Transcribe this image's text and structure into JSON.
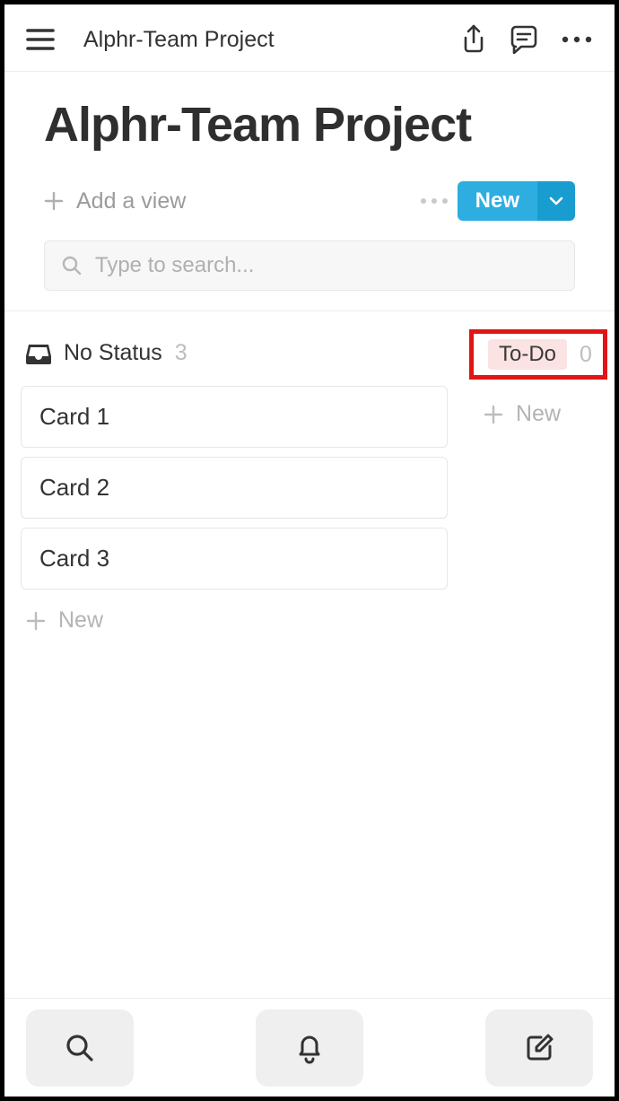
{
  "topbar": {
    "title": "Alphr-Team Project"
  },
  "page": {
    "title": "Alphr-Team Project"
  },
  "views": {
    "add_label": "Add a view",
    "new_label": "New"
  },
  "search": {
    "placeholder": "Type to search..."
  },
  "board": {
    "columns": [
      {
        "key": "no_status",
        "label": "No Status",
        "count": "3",
        "new_label": "New",
        "cards": [
          "Card 1",
          "Card 2",
          "Card 3"
        ]
      },
      {
        "key": "todo",
        "label": "To-Do",
        "count": "0",
        "new_label": "New",
        "cards": []
      }
    ]
  }
}
